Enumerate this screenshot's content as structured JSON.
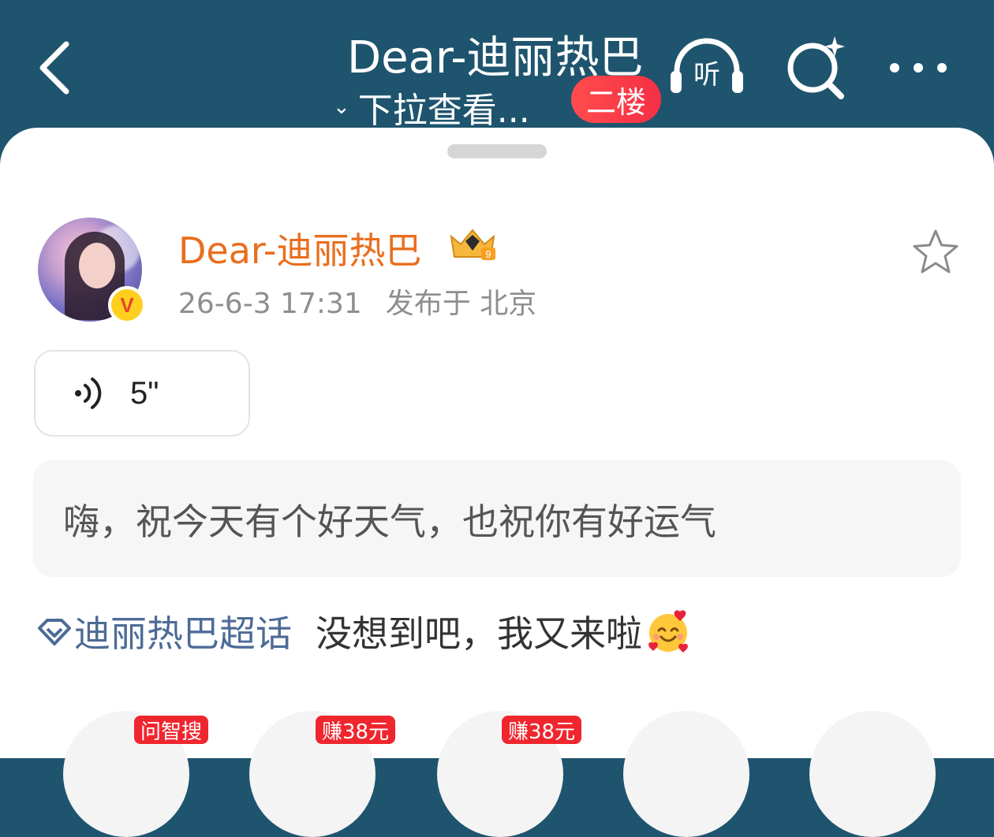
{
  "header": {
    "back_icon": "chevron-left-icon",
    "title": "Dear-迪丽热巴",
    "subtitle": "下拉查看...",
    "floor_badge": "二楼",
    "listen_label": "听",
    "search_icon": "ai-search-icon",
    "more_icon": "more-icon",
    "bar_color": "#1e546e"
  },
  "post": {
    "username": "Dear-迪丽热巴",
    "username_color": "#e96e1d",
    "level_badge": "9",
    "verified_mark": "V",
    "time": "26-6-3 17:31",
    "location": "发布于 北京",
    "voice_duration": "5\"",
    "quote_text": "嗨，祝今天有个好天气，也祝你有好运气",
    "topic": "迪丽热巴超话",
    "body": "没想到吧，我又来啦",
    "topic_color": "#4d6b96"
  },
  "bottom_tags": [
    "问智搜",
    "赚38元",
    "赚38元"
  ]
}
